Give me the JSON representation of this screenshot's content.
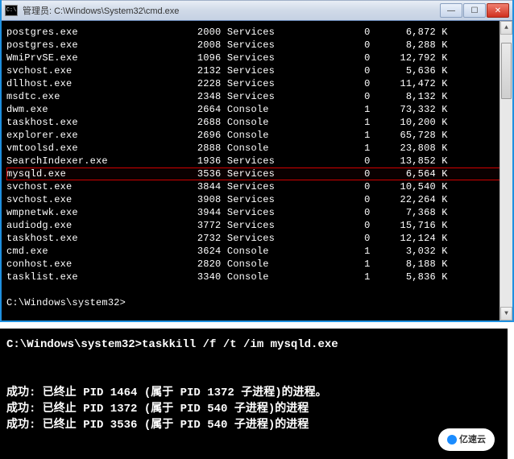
{
  "window": {
    "sysicon_text": "C:\\",
    "title": "管理员: C:\\Windows\\System32\\cmd.exe"
  },
  "processes": [
    {
      "name": "postgres.exe",
      "pid": "2000",
      "session": "Services",
      "snum": "0",
      "mem": "6,872 K",
      "hl": false
    },
    {
      "name": "postgres.exe",
      "pid": "2008",
      "session": "Services",
      "snum": "0",
      "mem": "8,288 K",
      "hl": false
    },
    {
      "name": "WmiPrvSE.exe",
      "pid": "1096",
      "session": "Services",
      "snum": "0",
      "mem": "12,792 K",
      "hl": false
    },
    {
      "name": "svchost.exe",
      "pid": "2132",
      "session": "Services",
      "snum": "0",
      "mem": "5,636 K",
      "hl": false
    },
    {
      "name": "dllhost.exe",
      "pid": "2228",
      "session": "Services",
      "snum": "0",
      "mem": "11,472 K",
      "hl": false
    },
    {
      "name": "msdtc.exe",
      "pid": "2348",
      "session": "Services",
      "snum": "0",
      "mem": "8,132 K",
      "hl": false
    },
    {
      "name": "dwm.exe",
      "pid": "2664",
      "session": "Console",
      "snum": "1",
      "mem": "73,332 K",
      "hl": false
    },
    {
      "name": "taskhost.exe",
      "pid": "2688",
      "session": "Console",
      "snum": "1",
      "mem": "10,200 K",
      "hl": false
    },
    {
      "name": "explorer.exe",
      "pid": "2696",
      "session": "Console",
      "snum": "1",
      "mem": "65,728 K",
      "hl": false
    },
    {
      "name": "vmtoolsd.exe",
      "pid": "2888",
      "session": "Console",
      "snum": "1",
      "mem": "23,808 K",
      "hl": false
    },
    {
      "name": "SearchIndexer.exe",
      "pid": "1936",
      "session": "Services",
      "snum": "0",
      "mem": "13,852 K",
      "hl": false
    },
    {
      "name": "mysqld.exe",
      "pid": "3536",
      "session": "Services",
      "snum": "0",
      "mem": "6,564 K",
      "hl": true
    },
    {
      "name": "svchost.exe",
      "pid": "3844",
      "session": "Services",
      "snum": "0",
      "mem": "10,540 K",
      "hl": false
    },
    {
      "name": "svchost.exe",
      "pid": "3908",
      "session": "Services",
      "snum": "0",
      "mem": "22,264 K",
      "hl": false
    },
    {
      "name": "wmpnetwk.exe",
      "pid": "3944",
      "session": "Services",
      "snum": "0",
      "mem": "7,368 K",
      "hl": false
    },
    {
      "name": "audiodg.exe",
      "pid": "3772",
      "session": "Services",
      "snum": "0",
      "mem": "15,716 K",
      "hl": false
    },
    {
      "name": "taskhost.exe",
      "pid": "2732",
      "session": "Services",
      "snum": "0",
      "mem": "12,124 K",
      "hl": false
    },
    {
      "name": "cmd.exe",
      "pid": "3624",
      "session": "Console",
      "snum": "1",
      "mem": "3,032 K",
      "hl": false
    },
    {
      "name": "conhost.exe",
      "pid": "2820",
      "session": "Console",
      "snum": "1",
      "mem": "8,188 K",
      "hl": false
    },
    {
      "name": "tasklist.exe",
      "pid": "3340",
      "session": "Console",
      "snum": "1",
      "mem": "5,836 K",
      "hl": false
    }
  ],
  "prompt": "C:\\Windows\\system32>",
  "second": {
    "prompt": "C:\\Windows\\system32>",
    "command": "taskkill /f /t /im mysqld.exe",
    "lines": [
      "成功: 已终止 PID 1464 (属于 PID 1372 子进程)的进程。",
      "成功: 已终止 PID 1372 (属于 PID 540 子进程)的进程",
      "成功: 已终止 PID 3536 (属于 PID 540 子进程)的进程"
    ]
  },
  "watermark": "亿速云"
}
